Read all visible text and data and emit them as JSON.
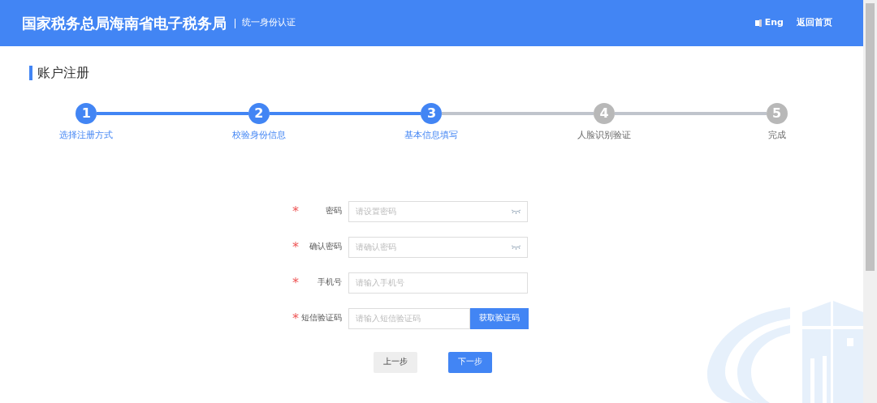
{
  "header": {
    "title": "国家税务总局海南省电子税务局",
    "subtitle": "统一身份认证",
    "language": "Eng",
    "home_link": "返回首页"
  },
  "page_title": "账户注册",
  "steps": [
    {
      "number": "1",
      "label": "选择注册方式",
      "done": true
    },
    {
      "number": "2",
      "label": "校验身份信息",
      "done": true
    },
    {
      "number": "3",
      "label": "基本信息填写",
      "done": true
    },
    {
      "number": "4",
      "label": "人脸识别验证",
      "done": false
    },
    {
      "number": "5",
      "label": "完成",
      "done": false
    }
  ],
  "form": [
    {
      "kind": "password",
      "label": "密码",
      "required_mark": "*",
      "placeholder": "请设置密码"
    },
    {
      "kind": "password",
      "label": "确认密码",
      "required_mark": "*",
      "placeholder": "请确认密码"
    },
    {
      "kind": "text",
      "label": "手机号",
      "required_mark": "*",
      "placeholder": "请输入手机号"
    },
    {
      "kind": "code",
      "label": "短信验证码",
      "required_mark": "*",
      "placeholder": "请输入短信验证码",
      "button": "获取验证码"
    }
  ],
  "buttons": [
    {
      "kind": "secondary",
      "label": "上一步"
    },
    {
      "kind": "primary",
      "label": "下一步"
    }
  ]
}
